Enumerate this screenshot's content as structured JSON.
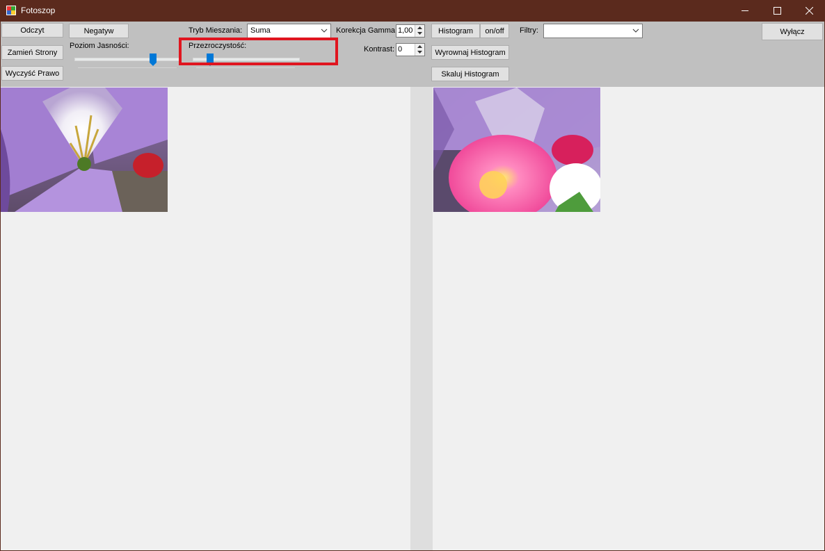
{
  "window": {
    "title": "Fotoszop"
  },
  "toolbar": {
    "odczyt": "Odczyt",
    "negatyw": "Negatyw",
    "zamien_strony": "Zamień Strony",
    "wyczysc_prawo": "Wyczyść Prawo",
    "poziom_jasnosci": "Poziom Jasności:",
    "przezroczystosc": "Przezroczystość:",
    "tryb_mieszania_label": "Tryb Mieszania:",
    "tryb_mieszania_value": "Suma",
    "korekcja_gamma_label": "Korekcja Gamma:",
    "korekcja_gamma_value": "1,00",
    "kontrast_label": "Kontrast:",
    "kontrast_value": "0",
    "histogram": "Histogram",
    "on_off": "on/off",
    "wyrownaj_histogram": "Wyrownaj Histogram",
    "skaluj_histogram": "Skaluj Histogram",
    "filtry_label": "Filtry:",
    "filtry_value": "",
    "wylacz": "Wyłącz"
  },
  "sliders": {
    "brightness_level": 0.73,
    "transparency_level": 0.16
  },
  "icons": [
    "app-icon",
    "minimize-icon",
    "maximize-icon",
    "close-icon",
    "dropdown-arrow-icon",
    "spin-up-icon",
    "spin-down-icon"
  ],
  "colors": {
    "titlebar": "#5b2a1d",
    "toolbar": "#c0c0c0",
    "highlight": "#e0151f",
    "slider_thumb": "#0078d7"
  }
}
